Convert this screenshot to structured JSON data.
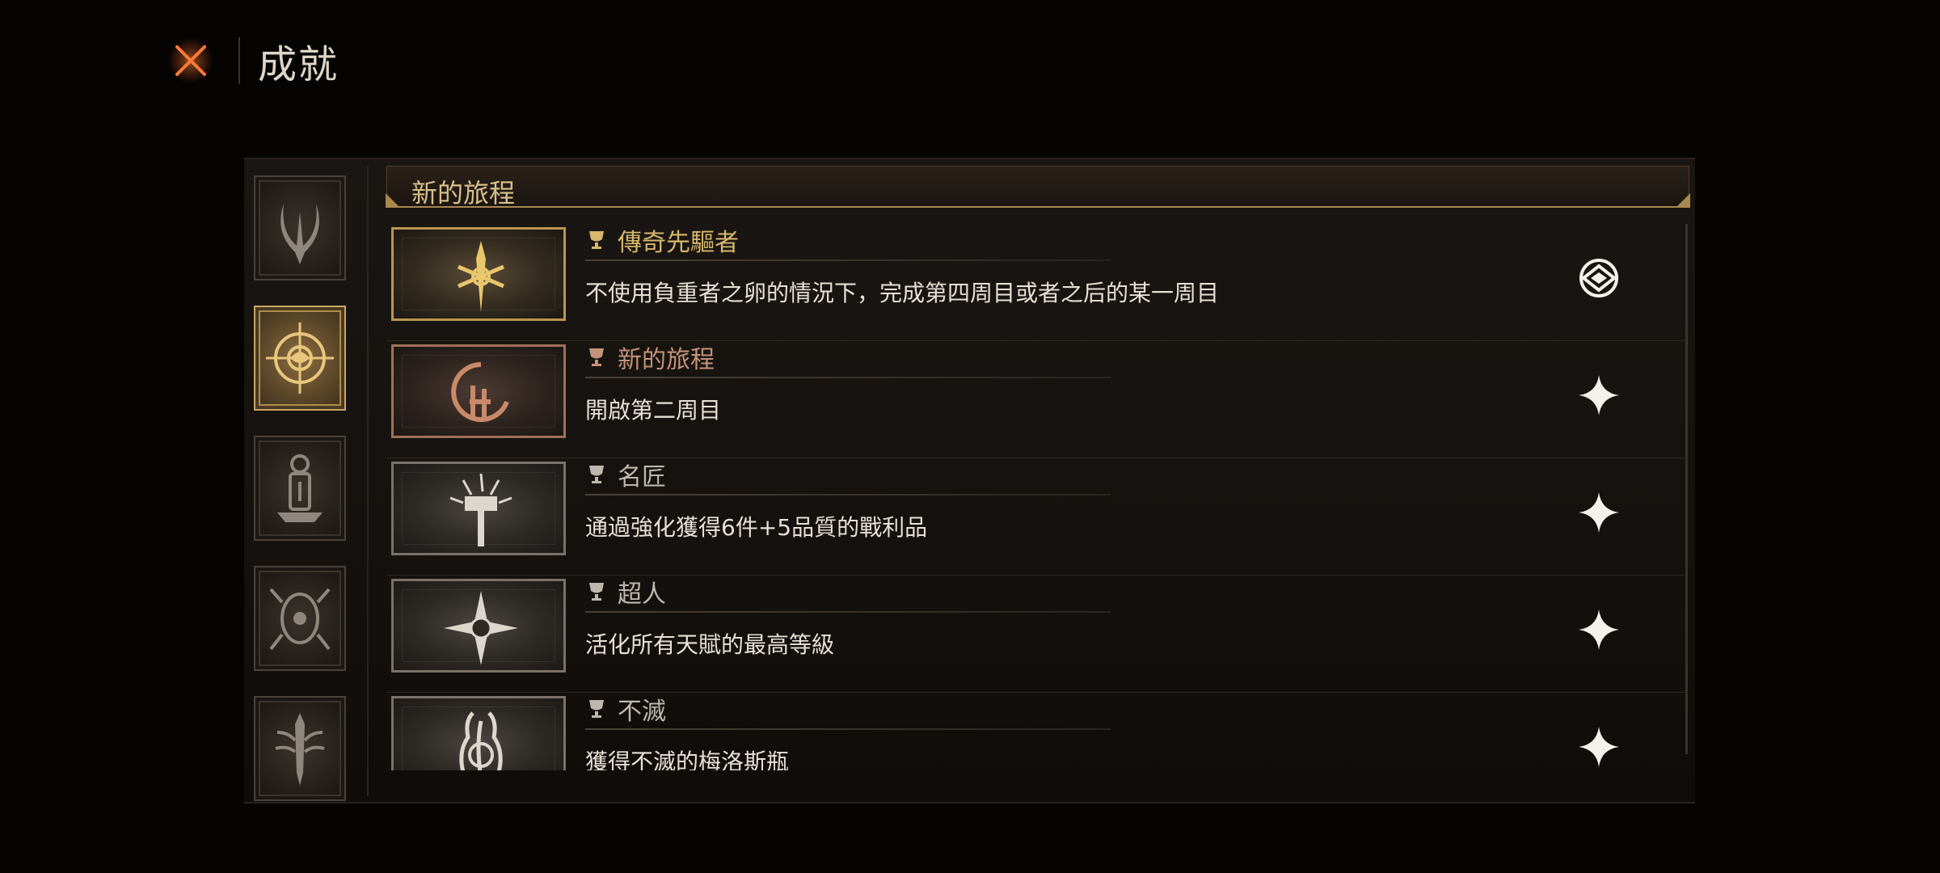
{
  "header": {
    "title": "成就",
    "close_icon": "close-x-icon",
    "accent_color": "#e0622b"
  },
  "sidebar": {
    "categories": [
      {
        "icon": "crescent-blade-icon",
        "active": false
      },
      {
        "icon": "compass-rune-icon",
        "active": true
      },
      {
        "icon": "lantern-idol-icon",
        "active": false
      },
      {
        "icon": "beast-mask-icon",
        "active": false
      },
      {
        "icon": "thorn-sword-icon",
        "active": false
      }
    ]
  },
  "section": {
    "title": "新的旅程"
  },
  "achievements": [
    {
      "name": "傳奇先驅者",
      "description": "不使用負重者之卵的情況下，完成第四周目或者之后的某一周目",
      "tier": "gold",
      "icon": "ornate-sword-emblem-icon",
      "status_icon": "completed-emblem-icon"
    },
    {
      "name": "新的旅程",
      "description": "開啟第二周目",
      "tier": "bronze",
      "icon": "spiral-rune-icon",
      "status_icon": "star-sparkle-icon"
    },
    {
      "name": "名匠",
      "description": "通過強化獲得6件+5品質的戰利品",
      "tier": "silver",
      "icon": "hammer-burst-icon",
      "status_icon": "star-sparkle-icon"
    },
    {
      "name": "超人",
      "description": "活化所有天賦的最高等級",
      "tier": "silver",
      "icon": "radiant-star-icon",
      "status_icon": "star-sparkle-icon"
    },
    {
      "name": "不滅",
      "description": "獲得不滅的梅洛斯瓶",
      "tier": "silver",
      "icon": "flame-hand-icon",
      "status_icon": "star-sparkle-icon"
    }
  ]
}
